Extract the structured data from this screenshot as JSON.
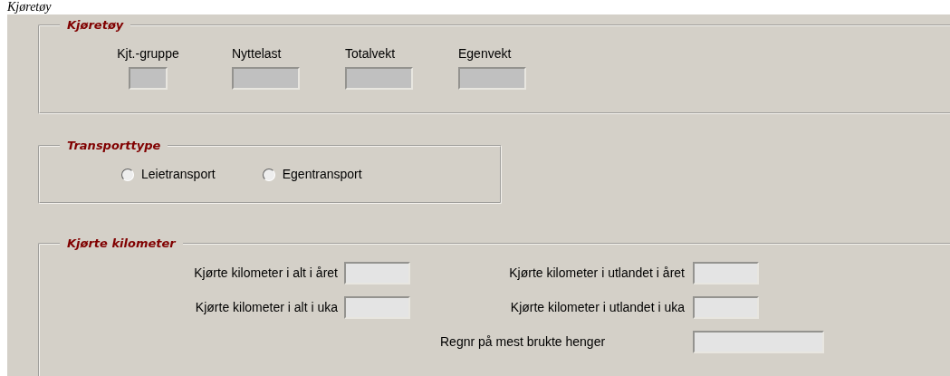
{
  "top_heading": "Kjøretøy",
  "vehicle": {
    "title": "Kjøretøy",
    "fields": [
      {
        "label": "Kjt.-gruppe",
        "kind": "narrow"
      },
      {
        "label": "Nyttelast",
        "kind": "normal"
      },
      {
        "label": "Totalvekt",
        "kind": "normal"
      },
      {
        "label": "Egenvekt",
        "kind": "normal"
      }
    ]
  },
  "transport_type": {
    "title": "Transporttype",
    "options": [
      {
        "label": "Leietransport",
        "selected": false
      },
      {
        "label": "Egentransport",
        "selected": false
      }
    ]
  },
  "driven_km": {
    "title": "Kjørte kilometer",
    "left": [
      {
        "label": "Kjørte kilometer i alt i året",
        "kind": "normal"
      },
      {
        "label": "Kjørte kilometer i alt i uka",
        "kind": "normal"
      }
    ],
    "right": [
      {
        "label": "Kjørte kilometer i utlandet i året",
        "kind": "normal"
      },
      {
        "label": "Kjørte kilometer i utlandet i uka",
        "kind": "normal"
      },
      {
        "label": "Regnr på mest brukte henger",
        "kind": "wide"
      }
    ]
  }
}
